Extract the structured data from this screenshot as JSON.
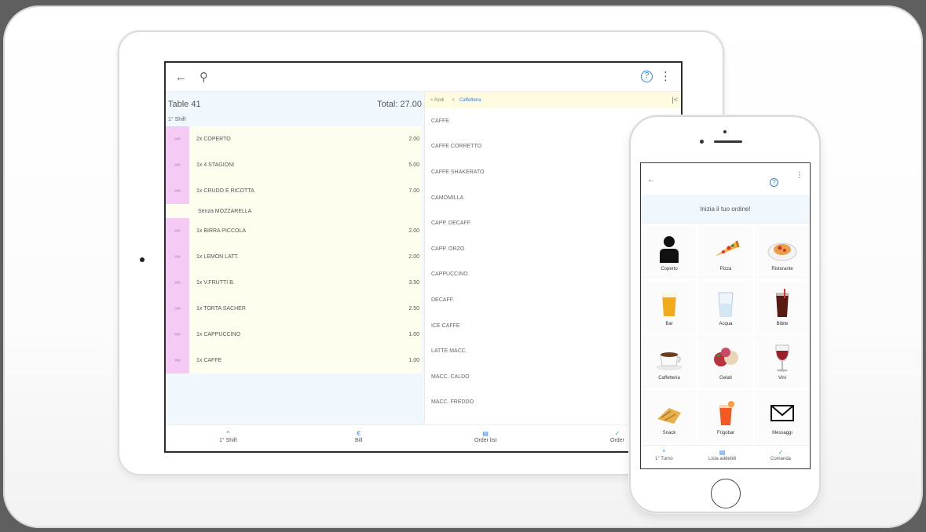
{
  "tablet": {
    "top_bar": {
      "back_icon": "back-arrow-icon",
      "search_icon": "search-icon",
      "help_icon": "help-icon",
      "more_icon": "more-vertical-icon"
    },
    "order": {
      "table": "Table 41",
      "total": "Total: 27.00",
      "shift_label": "1° Shift",
      "items": [
        {
          "name": "2x COPERTO",
          "price": "2.00"
        },
        {
          "name": "1x 4 STAGIONI",
          "price": "5.00"
        },
        {
          "name": "1x CRUDO E RICOTTA",
          "price": "7.00",
          "note": "Senza MOZZARELLA"
        },
        {
          "name": "1x BIRRA PICCOLA",
          "price": "2.00"
        },
        {
          "name": "1x LEMON LATT.",
          "price": "2.00"
        },
        {
          "name": "1x V.FRUTTI B.",
          "price": "3.50"
        },
        {
          "name": "1x TORTA SACHER",
          "price": "2.50"
        },
        {
          "name": "1x CAPPUCCINO",
          "price": "1.00"
        },
        {
          "name": "1x CAFFE",
          "price": "1.00"
        }
      ]
    },
    "breadcrumb": {
      "root": "Nodi",
      "current": "Caffetteria"
    },
    "products": [
      "CAFFE",
      "CAFFE CORRETTO",
      "CAFFE SHAKERATO",
      "CAMOMILLA",
      "CAPP. DECAFF.",
      "CAPP. ORZO",
      "CAPPUCCINO",
      "DECAFF.",
      "ICE CAFFE",
      "LATTE MACC.",
      "MACC. CALDO",
      "MACC. FREDDO"
    ],
    "bottom_nav": {
      "shift": "1° Shift",
      "bill": "Bill",
      "order_list": "Order list",
      "order": "Order"
    }
  },
  "phone": {
    "header": "Inizia il tuo ordine!",
    "categories": [
      {
        "label": "Coperto",
        "icon": "person-icon"
      },
      {
        "label": "Pizza",
        "icon": "pizza-icon"
      },
      {
        "label": "Ristorante",
        "icon": "pasta-plate-icon"
      },
      {
        "label": "Bar",
        "icon": "beer-glass-icon"
      },
      {
        "label": "Acqua",
        "icon": "water-glass-icon"
      },
      {
        "label": "Bibite",
        "icon": "cola-glass-icon"
      },
      {
        "label": "Caffetteria",
        "icon": "coffee-cup-icon"
      },
      {
        "label": "Gelati",
        "icon": "ice-cream-icon"
      },
      {
        "label": "Vini",
        "icon": "wine-glass-icon"
      },
      {
        "label": "Snack",
        "icon": "snack-icon"
      },
      {
        "label": "Frigobar",
        "icon": "cocktail-icon"
      },
      {
        "label": "Messaggi",
        "icon": "envelope-icon"
      }
    ],
    "bottom_nav": {
      "shift": "1° Turno",
      "list": "Lista addebiti",
      "order": "Comanda"
    }
  },
  "colors": {
    "accent": "#2f80ed",
    "handle": "#f5cbf5",
    "row_bg": "#fffdee",
    "pane_bg": "#f1f8fd"
  }
}
